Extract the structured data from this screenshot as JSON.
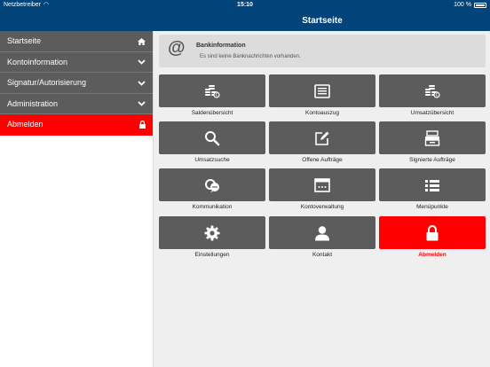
{
  "status_bar": {
    "carrier": "Netzbetreiber",
    "time": "15:10",
    "battery": "100 %"
  },
  "header": {
    "title": "Startseite"
  },
  "sidebar": {
    "items": [
      {
        "label": "Startseite",
        "icon": "home-icon"
      },
      {
        "label": "Kontoinformation",
        "icon": "chevron-down-icon"
      },
      {
        "label": "Signatur/Autorisierung",
        "icon": "chevron-down-icon"
      },
      {
        "label": "Administration",
        "icon": "chevron-down-icon"
      },
      {
        "label": "Abmelden",
        "icon": "lock-icon"
      }
    ]
  },
  "info": {
    "icon": "@",
    "title": "Bankinformation",
    "message": "Es sind keine Banknachrichten vorhanden."
  },
  "tiles": [
    {
      "label": "Saldenübersicht",
      "icon": "coins-icon"
    },
    {
      "label": "Kontoauszug",
      "icon": "statement-icon"
    },
    {
      "label": "Umsatzübersicht",
      "icon": "coins-icon"
    },
    {
      "label": "Umsatzsuche",
      "icon": "search-icon"
    },
    {
      "label": "Offene Aufträge",
      "icon": "edit-icon"
    },
    {
      "label": "Signierte Aufträge",
      "icon": "archive-icon"
    },
    {
      "label": "Kommunikation",
      "icon": "chat-icon"
    },
    {
      "label": "Kontoverwaltung",
      "icon": "window-icon"
    },
    {
      "label": "Menüpunkte",
      "icon": "list-icon"
    },
    {
      "label": "Einstellungen",
      "icon": "gear-icon"
    },
    {
      "label": "Kontakt",
      "icon": "person-icon"
    },
    {
      "label": "Abmelden",
      "icon": "lock-icon"
    }
  ],
  "colors": {
    "header": "#00447a",
    "tile": "#5c5c5c",
    "danger": "#ff0000"
  }
}
